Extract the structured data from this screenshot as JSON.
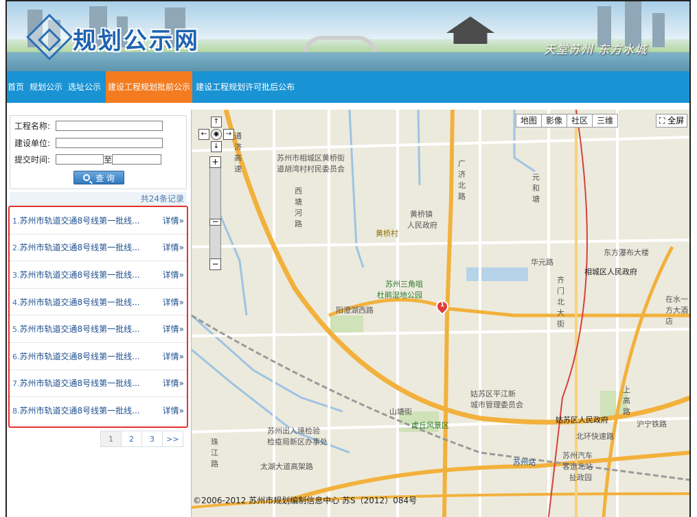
{
  "header": {
    "logo_text": "规划公示网",
    "slogan": "天堂苏州  东方水城"
  },
  "nav": {
    "items": [
      "首页",
      "规划公示",
      "选址公示",
      "建设工程规划批前公示",
      "建设工程规划许可批后公布"
    ],
    "active_index": 3
  },
  "search": {
    "project_name_label": "工程名称:",
    "builder_label": "建设单位:",
    "submit_time_label": "提交时间:",
    "to_label": "至",
    "project_name_value": "",
    "builder_value": "",
    "date_from_value": "",
    "date_to_value": "",
    "query_button": "查 询"
  },
  "results": {
    "count_text": "共24条记录",
    "items": [
      {
        "num": "1.",
        "title": "苏州市轨道交通8号线第一批线...",
        "detail": "详情»"
      },
      {
        "num": "2.",
        "title": "苏州市轨道交通8号线第一批线...",
        "detail": "详情»"
      },
      {
        "num": "3.",
        "title": "苏州市轨道交通8号线第一批线...",
        "detail": "详情»"
      },
      {
        "num": "4.",
        "title": "苏州市轨道交通8号线第一批线...",
        "detail": "详情»"
      },
      {
        "num": "5.",
        "title": "苏州市轨道交通8号线第一批线...",
        "detail": "详情»"
      },
      {
        "num": "6.",
        "title": "苏州市轨道交通8号线第一批线...",
        "detail": "详情»"
      },
      {
        "num": "7.",
        "title": "苏州市轨道交通8号线第一批线...",
        "detail": "详情»"
      },
      {
        "num": "8.",
        "title": "苏州市轨道交通8号线第一批线...",
        "detail": "详情»"
      }
    ]
  },
  "pager": {
    "pages": [
      "1",
      "2",
      "3",
      ">>"
    ],
    "current": "1"
  },
  "map": {
    "type_buttons": [
      "地图",
      "影像",
      "社区",
      "三维"
    ],
    "fullscreen": "全屏",
    "marker_label": "1",
    "copyright": "©2006-2012 苏州市规划编制信息中心  苏S（2012）084号",
    "labels": {
      "l1": "苏州市相城区黄桥街",
      "l2": "道胡湾村村民委员会",
      "l3": "黄桥镇",
      "l4": "人民政府",
      "l5": "黄桥村",
      "l6": "苏州三角咀",
      "l7": "杜鹃湿地公园",
      "l8": "广济北路",
      "l9": "元和塘",
      "l10": "东方瀑布大楼",
      "l11": "华元路",
      "l12": "相城区人民政府",
      "l13": "齐门北大街",
      "l14": "阳澄湖西路",
      "l15": "姑苏区平江新",
      "l16": "城市管理委员会",
      "l17": "姑苏区人民政府",
      "l18": "虎丘风景区",
      "l19": "苏州出入境检验",
      "l20": "检疫局新区办事处",
      "l21": "北环快速路",
      "l22": "苏州站",
      "l23": "苏州汽车",
      "l24": "客运北站",
      "l25": "太湖大道高架路",
      "l26": "沪宁铁路",
      "l27": "山塘街",
      "l28": "珠江路",
      "l29": "西塘河路",
      "l30": "通济高速",
      "l31": "在水一方大酒店",
      "l32": "扯政园",
      "l33": "上高路"
    }
  }
}
